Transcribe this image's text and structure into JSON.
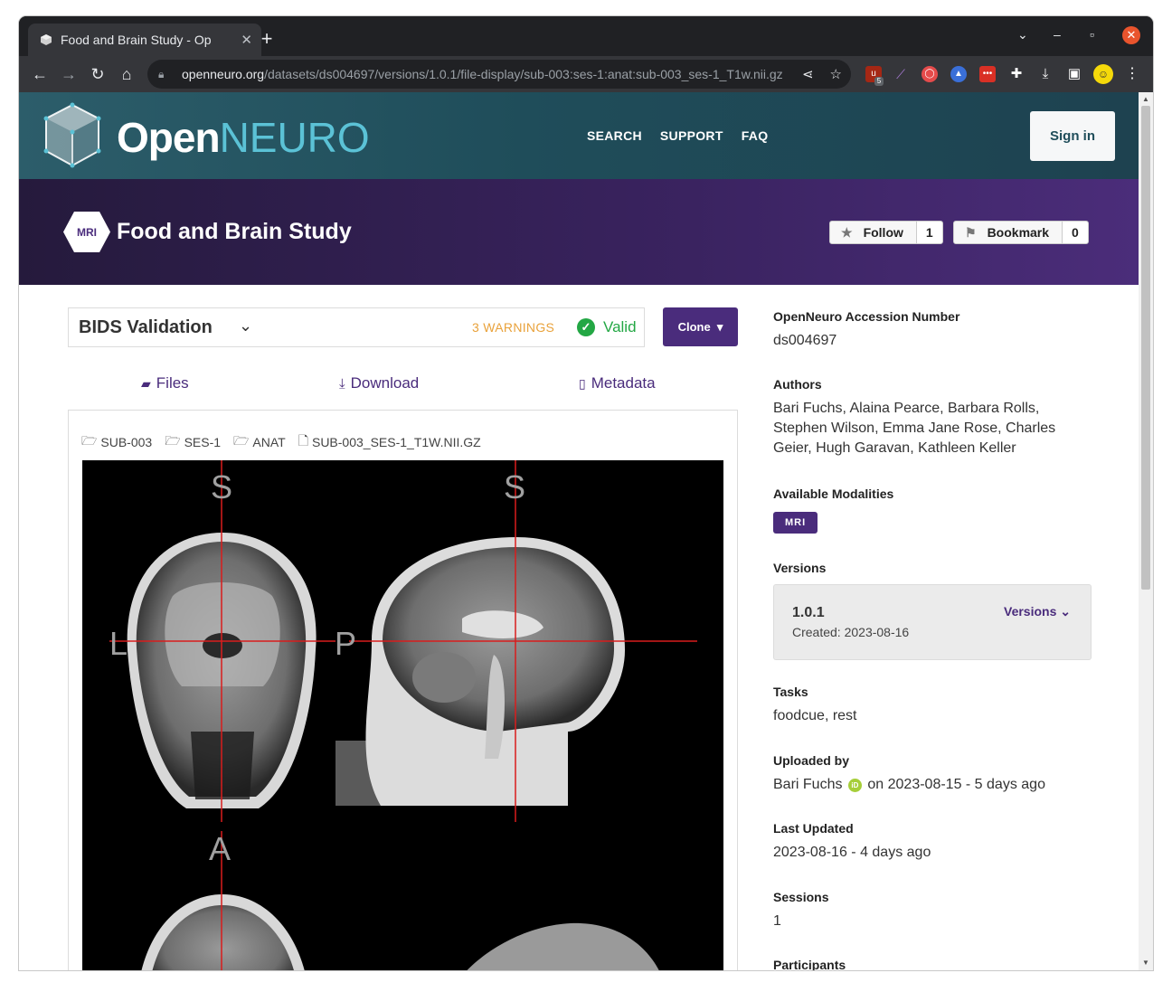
{
  "browser": {
    "tab_title": "Food and Brain Study - Op",
    "url_host": "openneuro.org",
    "url_path": "/datasets/ds004697/versions/1.0.1/file-display/sub-003:ses-1:anat:sub-003_ses-1_T1w.nii.gz",
    "extension_badge": "5"
  },
  "site": {
    "logo_open": "Open",
    "logo_neuro": "NEURO",
    "nav": [
      "SEARCH",
      "SUPPORT",
      "FAQ"
    ],
    "signin_label": "Sign in"
  },
  "dataset": {
    "modality_hex": "MRI",
    "title": "Food and Brain Study",
    "follow_label": "Follow",
    "follow_count": "1",
    "bookmark_label": "Bookmark",
    "bookmark_count": "0"
  },
  "validation": {
    "title": "BIDS Validation",
    "warnings": "3 WARNINGS",
    "status": "Valid",
    "clone_label": "Clone"
  },
  "tabs": {
    "files": "Files",
    "download": "Download",
    "metadata": "Metadata"
  },
  "breadcrumb": [
    "SUB-003",
    "SES-1",
    "ANAT",
    "SUB-003_SES-1_T1W.NII.GZ"
  ],
  "viewer": {
    "labels": {
      "coronal_top": "S",
      "sagittal_top": "S",
      "coronal_left": "L",
      "sagittal_left": "P",
      "axial_top": "A"
    }
  },
  "sidebar": {
    "accession_label": "OpenNeuro Accession Number",
    "accession_value": "ds004697",
    "authors_label": "Authors",
    "authors_value": "Bari Fuchs, Alaina Pearce, Barbara Rolls, Stephen Wilson, Emma Jane Rose, Charles Geier, Hugh Garavan, Kathleen Keller",
    "modalities_label": "Available Modalities",
    "modality_badge": "MRI",
    "versions_label": "Versions",
    "version_number": "1.0.1",
    "version_created": "Created: 2023-08-16",
    "versions_link": "Versions",
    "tasks_label": "Tasks",
    "tasks_value": "foodcue, rest",
    "uploaded_label": "Uploaded by",
    "uploader_name": "Bari Fuchs",
    "orcid_icon_text": "iD",
    "uploaded_when": "on 2023-08-15 - 5 days ago",
    "updated_label": "Last Updated",
    "updated_value": "2023-08-16 - 4 days ago",
    "sessions_label": "Sessions",
    "sessions_value": "1",
    "participants_label": "Participants"
  },
  "colors": {
    "brand_purple": "#4a2c7c",
    "teal_header": "#1f4d5a",
    "valid_green": "#23a744",
    "warning_orange": "#e9a23b"
  }
}
